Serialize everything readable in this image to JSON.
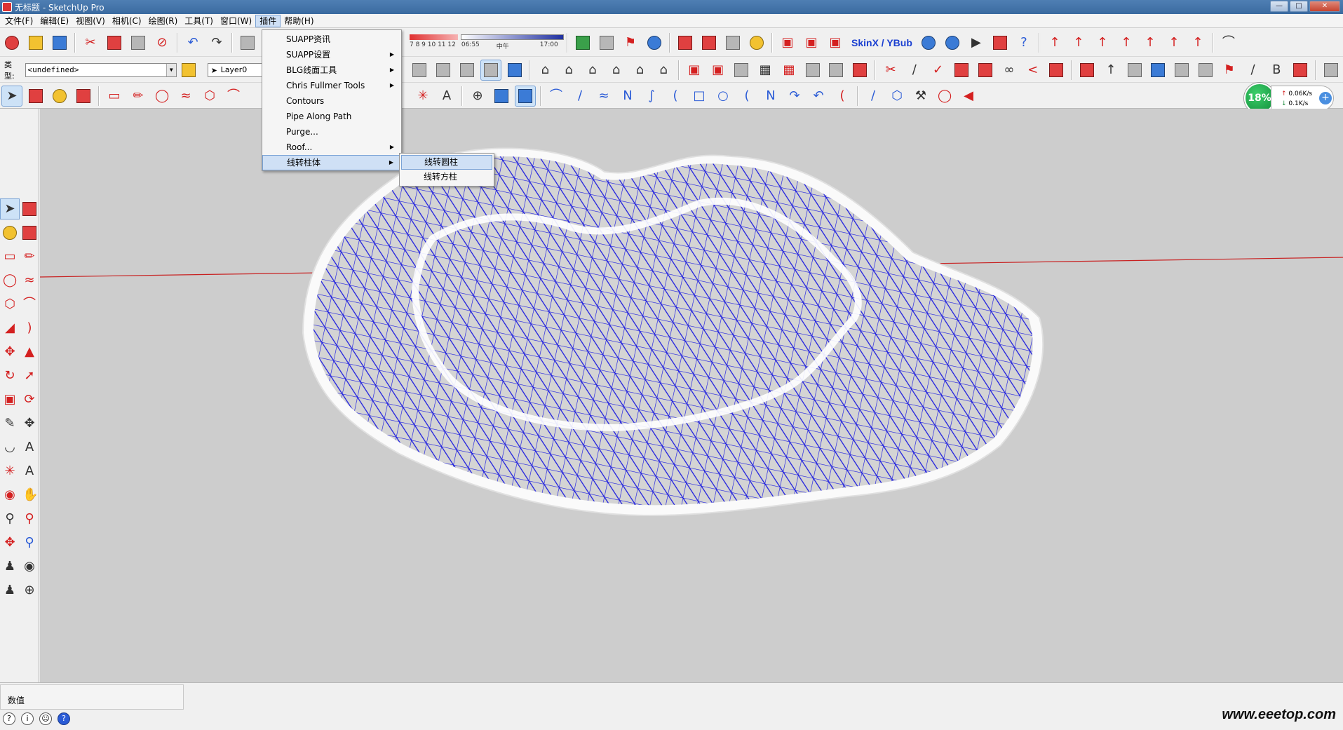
{
  "window": {
    "title": "无标题 - SketchUp Pro"
  },
  "menubar": {
    "items": [
      "文件(F)",
      "编辑(E)",
      "视图(V)",
      "相机(C)",
      "绘图(R)",
      "工具(T)",
      "窗口(W)",
      "插件",
      "帮助(H)"
    ],
    "active": "插件"
  },
  "plugins_menu": {
    "items": [
      {
        "label": "SUAPP资讯",
        "submenu": false
      },
      {
        "label": "SUAPP设置",
        "submenu": true
      },
      {
        "label": "BLG线面工具",
        "submenu": true
      },
      {
        "label": "Chris Fullmer Tools",
        "submenu": true
      },
      {
        "label": "Contours",
        "submenu": false
      },
      {
        "label": "Pipe Along Path",
        "submenu": false
      },
      {
        "label": "Purge...",
        "submenu": false
      },
      {
        "label": "Roof...",
        "submenu": true
      },
      {
        "label": "线转柱体",
        "submenu": true
      }
    ],
    "active": "线转柱体",
    "submenu_items": [
      "线转圆柱",
      "线转方柱"
    ],
    "submenu_active": "线转圆柱"
  },
  "layer_toolbar": {
    "type_label": "类型:",
    "type_value": "<undefined>",
    "layer_value": "Layer0"
  },
  "shadow_toolbar": {
    "month_ticks": "7 8 9 10 11 12",
    "time_start": "06:55",
    "time_mid": "中午",
    "time_end": "17:00"
  },
  "skin_toolbar": {
    "label": "SkinX / YBub"
  },
  "net_monitor": {
    "percent": "18%",
    "upload": "0.06K/s",
    "download": "0.1K/s",
    "plus": "+"
  },
  "status_bar": {
    "vcb_label": "数值"
  },
  "watermark": "www.eeetop.com",
  "colors": {
    "mesh": "#1a1ae0",
    "viewport": "#cdcdcd",
    "red_axis": "#c82020",
    "accent": "#cfe0f5"
  },
  "icons": [
    "new-icon",
    "open-icon",
    "save-icon",
    "cut-icon",
    "copy-icon",
    "paste-icon",
    "erase-icon",
    "undo-icon",
    "redo-icon",
    "print-icon",
    "select-icon",
    "component-icon",
    "paint-icon",
    "eraser-icon"
  ]
}
